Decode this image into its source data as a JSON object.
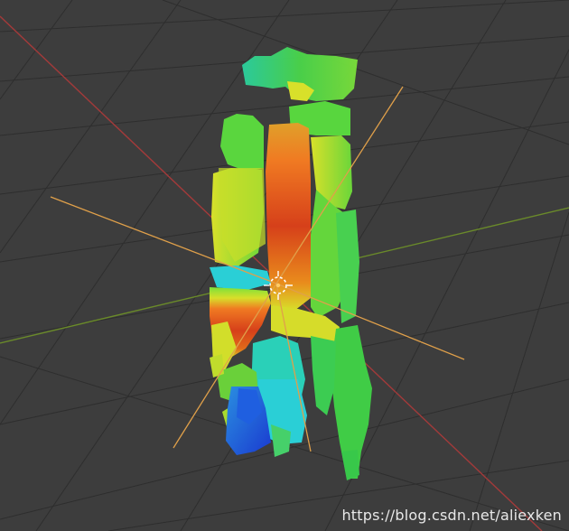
{
  "viewport": {
    "label": "3d-viewport",
    "colors": {
      "background": "#3d3d3d",
      "grid_line": "#2f2f2f",
      "x_axis": "#a33a3a",
      "y_axis": "#6a8a2a",
      "orange_lines": "#e0a04a",
      "cyan": "#2ad0d8",
      "green": "#4ad64a",
      "yellow": "#d8e02a",
      "orange": "#f07a22",
      "red": "#d6401a",
      "blue": "#1f5fe0"
    }
  },
  "objects": {
    "point_cloud": "colored-point-cloud",
    "camera_lines": "orange-ray-lines",
    "origin": "object-origin-marker"
  },
  "watermark": {
    "text": "https://blog.csdn.net/aliexken"
  }
}
